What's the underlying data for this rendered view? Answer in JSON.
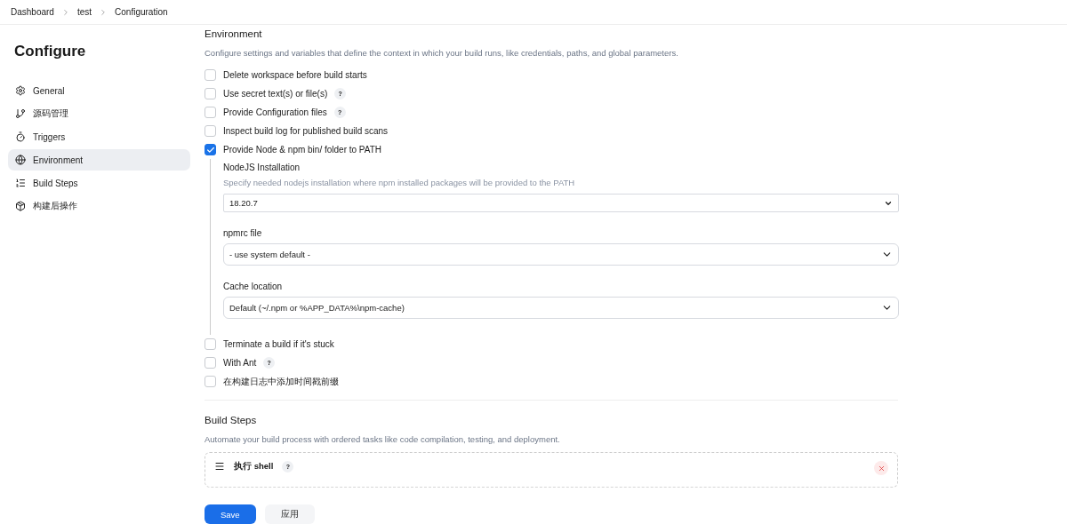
{
  "breadcrumbs": [
    "Dashboard",
    "test",
    "Configuration"
  ],
  "sidebar": {
    "title": "Configure",
    "items": [
      {
        "label": "General",
        "selected": false
      },
      {
        "label": "源码管理",
        "selected": false
      },
      {
        "label": "Triggers",
        "selected": false
      },
      {
        "label": "Environment",
        "selected": true
      },
      {
        "label": "Build Steps",
        "selected": false
      },
      {
        "label": "构建后操作",
        "selected": false
      }
    ]
  },
  "environment": {
    "title": "Environment",
    "description": "Configure settings and variables that define the context in which your build runs, like credentials, paths, and global parameters.",
    "options": [
      {
        "label": "Delete workspace before build starts",
        "checked": false
      },
      {
        "label": "Use secret text(s) or file(s)",
        "checked": false,
        "help": "?"
      },
      {
        "label": "Provide Configuration files",
        "checked": false,
        "help": "?"
      },
      {
        "label": "Inspect build log for published build scans",
        "checked": false
      },
      {
        "label": "Provide Node & npm bin/ folder to PATH",
        "checked": true,
        "fields": [
          {
            "label": "NodeJS Installation",
            "hint": "Specify needed nodejs installation where npm installed packages will be provided to the PATH",
            "value": "18.20.7",
            "kind": "plain"
          },
          {
            "label": "npmrc file",
            "value": "- use system default -",
            "kind": "rounded"
          },
          {
            "label": "Cache location",
            "value": "Default (~/.npm or %APP_DATA%\\npm-cache)",
            "kind": "rounded"
          }
        ]
      },
      {
        "label": "Terminate a build if it's stuck",
        "checked": false
      },
      {
        "label": "With Ant",
        "checked": false,
        "help": "?"
      },
      {
        "label": "在构建日志中添加时间戳前缀",
        "checked": false
      }
    ]
  },
  "build_steps": {
    "title": "Build Steps",
    "description": "Automate your build process with ordered tasks like code compilation, testing, and deployment.",
    "steps": [
      {
        "title": "执行 shell",
        "help": "?"
      }
    ]
  },
  "footer": {
    "buttons": [
      {
        "label": "Save",
        "kind": "primary"
      },
      {
        "label": "应用",
        "kind": "secondary"
      }
    ]
  }
}
